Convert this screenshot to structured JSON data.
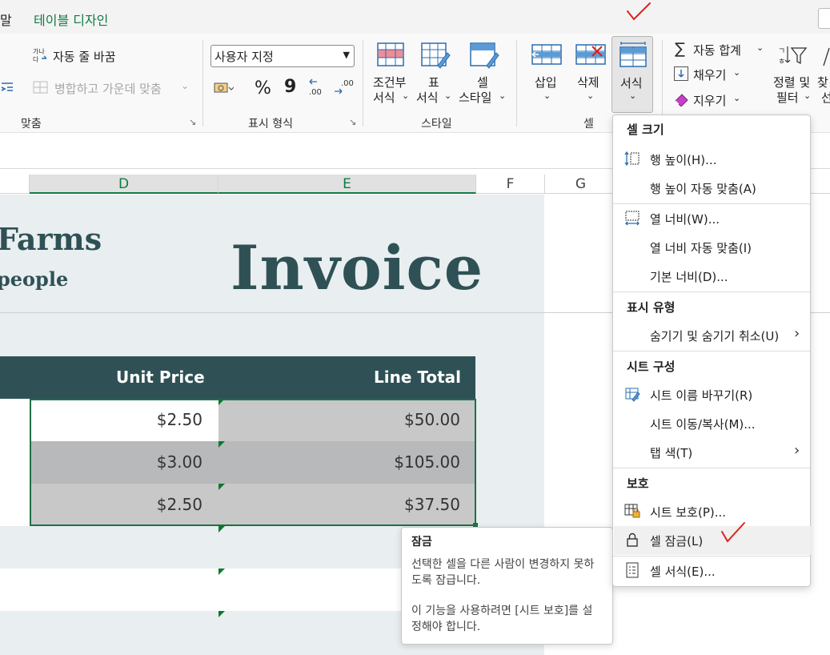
{
  "tabs": {
    "partial": "말",
    "design": "테이블 디자인"
  },
  "ribbon": {
    "wrap_text": "자동 줄 바꿈",
    "merge_center": "병합하고 가운데 맞춤",
    "align_group": "맞춤",
    "number_format": "사용자 지정",
    "number_group": "표시 형식",
    "conditional_fmt": [
      "조건부",
      "서식"
    ],
    "format_table": [
      "표",
      "서식"
    ],
    "cell_styles": [
      "셀",
      "스타일"
    ],
    "styles_group": "스타일",
    "insert": "삽입",
    "delete": "삭제",
    "format": "서식",
    "cells_group": "셀",
    "autosum": "자동 합계",
    "fill": "채우기",
    "clear": "지우기",
    "sort_filter": [
      "정렬 및",
      "필터"
    ],
    "find_partial": [
      "찾",
      "선"
    ],
    "percent": "%",
    "comma": "9",
    "dec_inc": ".00",
    "dec_dec": ".00"
  },
  "columns": [
    "D",
    "E",
    "F",
    "G"
  ],
  "sheet": {
    "brand_line1": "Farms",
    "brand_line2": "people",
    "title": "Invoice",
    "header_unit_price": "Unit Price",
    "header_line_total": "Line Total",
    "rows": [
      {
        "unit": "$2.50",
        "total": "$50.00"
      },
      {
        "unit": "$3.00",
        "total": "$105.00"
      },
      {
        "unit": "$2.50",
        "total": "$37.50"
      }
    ]
  },
  "menu": {
    "sec_cell_size": "셀 크기",
    "row_height": "행 높이(H)...",
    "autofit_row": "행 높이 자동 맞춤(A)",
    "col_width": "열 너비(W)...",
    "autofit_col": "열 너비 자동 맞춤(I)",
    "default_width": "기본 너비(D)...",
    "sec_visibility": "표시 유형",
    "hide_unhide": "숨기기 및 숨기기 취소(U)",
    "sec_organize": "시트 구성",
    "rename_sheet": "시트 이름 바꾸기(R)",
    "move_copy": "시트 이동/복사(M)...",
    "tab_color": "탭 색(T)",
    "sec_protection": "보호",
    "protect_sheet": "시트 보호(P)...",
    "lock_cell": "셀 잠금(L)",
    "format_cells": "셀 서식(E)..."
  },
  "tooltip": {
    "title": "잠금",
    "desc": "선택한 셀을 다른 사람이 변경하지 못하도록 잠급니다.",
    "note": "이 기능을 사용하려면 [시트 보호]를 설정해야 합니다."
  },
  "colors": {
    "accent": "#107c41",
    "header_band": "#2f5155",
    "annotation": "#e0201a"
  }
}
